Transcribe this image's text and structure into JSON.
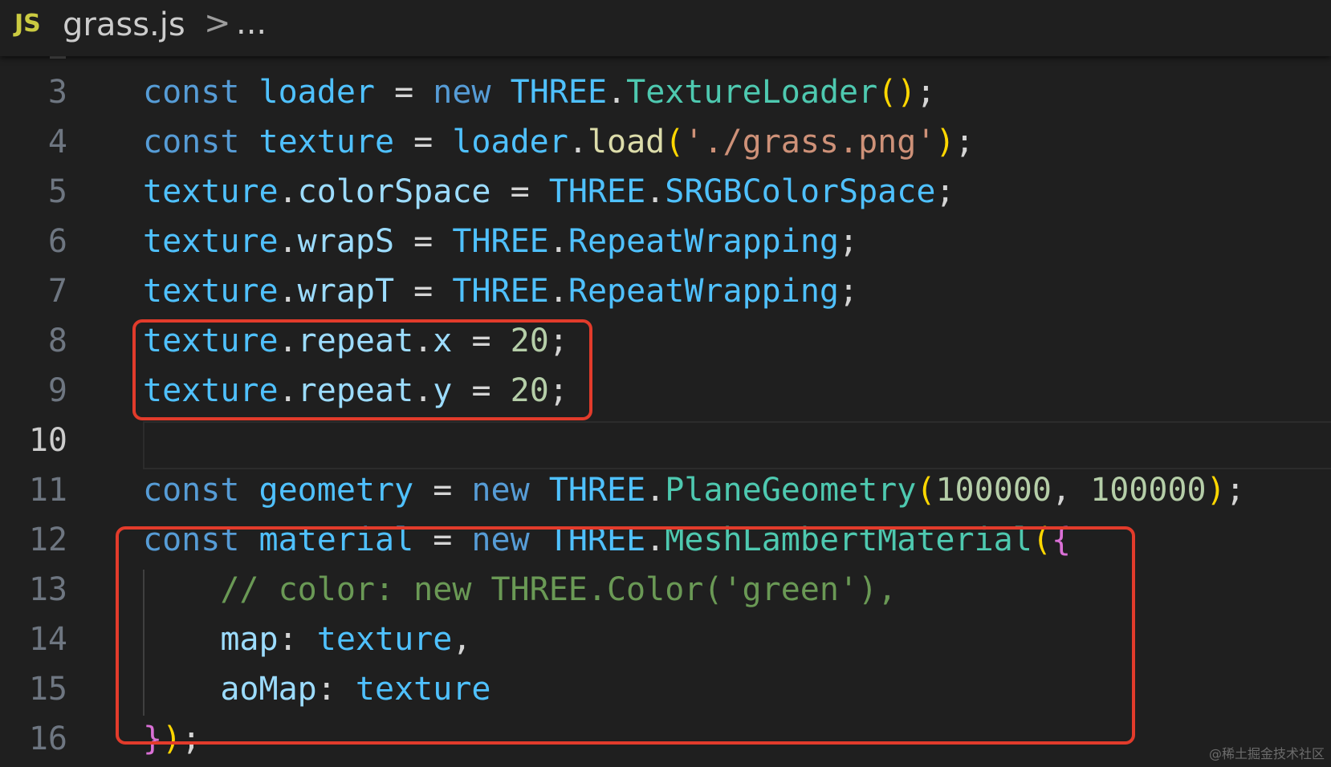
{
  "breadcrumb": {
    "language_badge": "JS",
    "file_name": "grass.js",
    "separator": ">",
    "more": "..."
  },
  "editor": {
    "active_line": "10",
    "lines": [
      {
        "n": "3",
        "tokens": [
          "const",
          " ",
          "loader",
          " = ",
          "new",
          " ",
          "THREE",
          ".",
          "TextureLoader",
          "(",
          ")",
          ";"
        ]
      },
      {
        "n": "4",
        "tokens": [
          "const",
          " ",
          "texture",
          " = ",
          "loader",
          ".",
          "load",
          "(",
          "'./grass.png'",
          ")",
          ";"
        ]
      },
      {
        "n": "5",
        "tokens": [
          "texture",
          ".",
          "colorSpace",
          " = ",
          "THREE",
          ".",
          "SRGBColorSpace",
          ";"
        ]
      },
      {
        "n": "6",
        "tokens": [
          "texture",
          ".",
          "wrapS",
          " = ",
          "THREE",
          ".",
          "RepeatWrapping",
          ";"
        ]
      },
      {
        "n": "7",
        "tokens": [
          "texture",
          ".",
          "wrapT",
          " = ",
          "THREE",
          ".",
          "RepeatWrapping",
          ";"
        ]
      },
      {
        "n": "8",
        "tokens": [
          "texture",
          ".",
          "repeat",
          ".",
          "x",
          " = ",
          "20",
          ";"
        ]
      },
      {
        "n": "9",
        "tokens": [
          "texture",
          ".",
          "repeat",
          ".",
          "y",
          " = ",
          "20",
          ";"
        ]
      },
      {
        "n": "10",
        "tokens": []
      },
      {
        "n": "11",
        "tokens": [
          "const",
          " ",
          "geometry",
          " = ",
          "new",
          " ",
          "THREE",
          ".",
          "PlaneGeometry",
          "(",
          "100000",
          ", ",
          "100000",
          ")",
          ";"
        ]
      },
      {
        "n": "12",
        "tokens": [
          "const",
          " ",
          "material",
          " = ",
          "new",
          " ",
          "THREE",
          ".",
          "MeshLambertMaterial",
          "(",
          "{"
        ]
      },
      {
        "n": "13",
        "tokens": [
          "    ",
          "// color: new THREE.Color('green'),"
        ]
      },
      {
        "n": "14",
        "tokens": [
          "    ",
          "map",
          ": ",
          "texture",
          ","
        ]
      },
      {
        "n": "15",
        "tokens": [
          "    ",
          "aoMap",
          ": ",
          "texture"
        ]
      },
      {
        "n": "16",
        "tokens": [
          "}",
          ")",
          ";"
        ]
      }
    ]
  },
  "watermark": "@稀土掘金技术社区"
}
